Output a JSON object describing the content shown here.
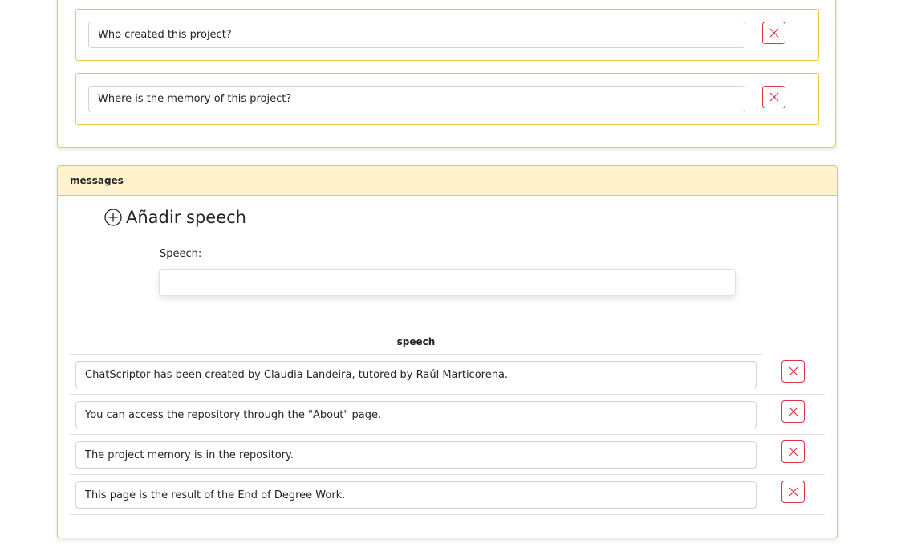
{
  "questions": [
    {
      "value": "Who created this project?"
    },
    {
      "value": "Where is the memory of this project?"
    }
  ],
  "messages": {
    "header": "messages",
    "add_label": "Añadir speech",
    "speech_label": "Speech:",
    "speech_value": "",
    "column_header": "speech",
    "rows": [
      {
        "value": "ChatScriptor has been created by Claudia Landeira, tutored by Raúl Marticorena."
      },
      {
        "value": "You can access the repository through the \"About\" page."
      },
      {
        "value": "The project memory is in the repository."
      },
      {
        "value": "This page is the result of the End of Degree Work."
      }
    ]
  },
  "icons": {
    "delete": "close-icon",
    "add": "plus-circle-icon"
  },
  "colors": {
    "accent_border": "#f0c93a",
    "header_bg": "#fff3cd",
    "danger": "#dc3545"
  }
}
